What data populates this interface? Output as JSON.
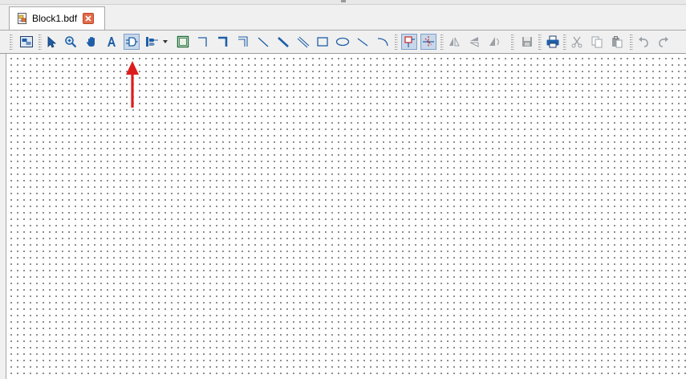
{
  "tab": {
    "label": "Block1.bdf"
  },
  "toolbar": {
    "items": [
      "block-editor-icon",
      "selection-tool-icon",
      "zoom-tool-icon",
      "hand-tool-icon",
      "text-tool-icon",
      "symbol-tool-icon",
      "pin-tool-icon",
      "block-tool-icon",
      "orthogonal-node-tool-icon",
      "orthogonal-bus-tool-icon",
      "orthogonal-conduit-tool-icon",
      "diagonal-node-tool-icon",
      "diagonal-bus-tool-icon",
      "diagonal-conduit-tool-icon",
      "rectangle-tool-icon",
      "oval-tool-icon",
      "line-tool-icon",
      "arc-tool-icon",
      "rubberbanding-icon",
      "partial-line-selection-icon",
      "flip-horizontal-icon",
      "flip-vertical-icon",
      "rotate-icon",
      "save-icon",
      "print-icon",
      "cut-icon",
      "copy-icon",
      "paste-icon",
      "undo-icon",
      "redo-icon"
    ]
  },
  "colors": {
    "accent": "#1f5fa8",
    "annotation_arrow": "#dd1c1c",
    "close_button": "#e36b4b"
  }
}
